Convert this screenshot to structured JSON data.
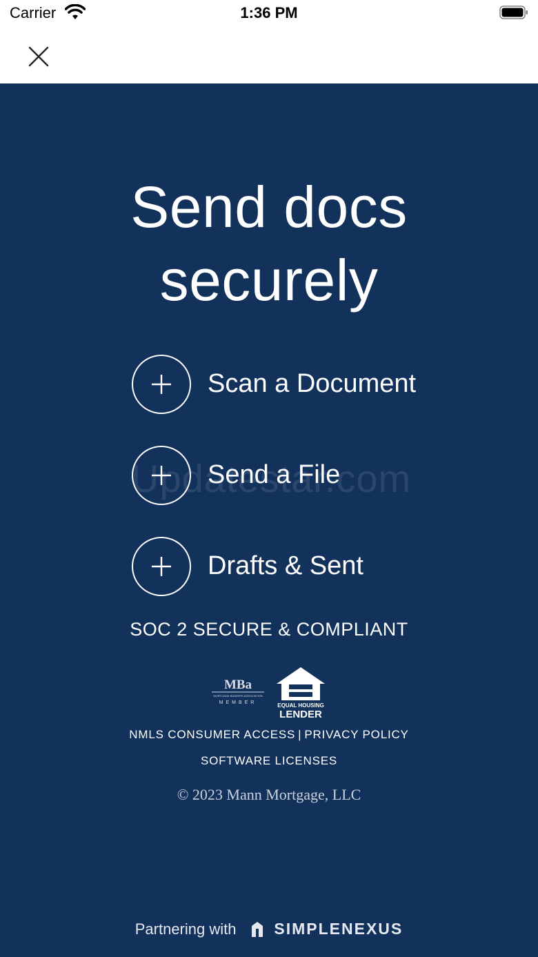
{
  "status_bar": {
    "carrier": "Carrier",
    "time": "1:36 PM",
    "icons": [
      "wifi-icon",
      "battery-icon"
    ]
  },
  "nav": {
    "close_icon": "close-icon"
  },
  "main": {
    "headline_line1": "Send docs",
    "headline_line2": "securely",
    "actions": [
      {
        "label": "Scan a Document",
        "icon": "plus-icon"
      },
      {
        "label": "Send a File",
        "icon": "plus-icon"
      },
      {
        "label": "Drafts & Sent",
        "icon": "plus-icon"
      }
    ],
    "watermark": "Updatestar.com",
    "soc": "SOC 2 SECURE & COMPLIANT",
    "logos": {
      "mba_text": "MBa",
      "mba_sub": "MORTGAGE BANKERS ASSOCIATION",
      "mba_member": "MEMBER",
      "ehl_line1": "EQUAL HOUSING",
      "ehl_line2": "LENDER"
    },
    "links": {
      "nmls": "NMLS CONSUMER ACCESS",
      "separator": "|",
      "privacy": "PRIVACY POLICY",
      "licenses": "SOFTWARE LICENSES"
    },
    "copyright": "© 2023 Mann Mortgage, LLC",
    "partner": {
      "prefix": "Partnering with",
      "brand": "SIMPLENEXUS"
    }
  },
  "colors": {
    "primary_bg": "#13325b",
    "text": "#ffffff"
  }
}
